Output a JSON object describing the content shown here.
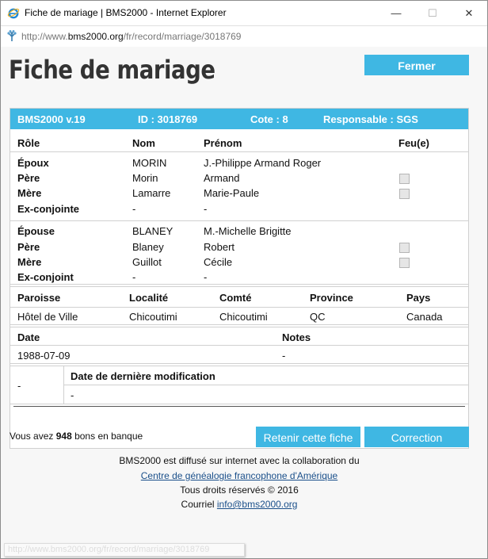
{
  "window": {
    "title": "Fiche de mariage | BMS2000 - Internet Explorer",
    "minimize": "—",
    "maximize": "☐",
    "close": "✕"
  },
  "address": {
    "prefix": "http://www.",
    "host": "bms2000.org",
    "path": "/fr/record/marriage/3018769"
  },
  "page": {
    "title": "Fiche de mariage",
    "close_button": "Fermer"
  },
  "record": {
    "header": {
      "version": "BMS2000 v.19",
      "id": "ID : 3018769",
      "cote": "Cote : 8",
      "responsable": "Responsable : SGS"
    },
    "columns": {
      "role": "Rôle",
      "nom": "Nom",
      "prenom": "Prénom",
      "feu": "Feu(e)"
    },
    "groom_group": [
      {
        "role": "Époux",
        "nom": "MORIN",
        "prenom": "J.-Philippe Armand Roger",
        "checkbox": false
      },
      {
        "role": "Père",
        "nom": "Morin",
        "prenom": "Armand",
        "checkbox": true
      },
      {
        "role": "Mère",
        "nom": "Lamarre",
        "prenom": "Marie-Paule",
        "checkbox": true
      },
      {
        "role": "Ex-conjointe",
        "nom": "-",
        "prenom": "-",
        "checkbox": false
      }
    ],
    "bride_group": [
      {
        "role": "Épouse",
        "nom": "BLANEY",
        "prenom": "M.-Michelle Brigitte",
        "checkbox": false
      },
      {
        "role": "Père",
        "nom": "Blaney",
        "prenom": "Robert",
        "checkbox": true
      },
      {
        "role": "Mère",
        "nom": "Guillot",
        "prenom": "Cécile",
        "checkbox": true
      },
      {
        "role": "Ex-conjoint",
        "nom": "-",
        "prenom": "-",
        "checkbox": false
      }
    ],
    "place": {
      "labels": {
        "paroisse": "Paroisse",
        "localite": "Localité",
        "comte": "Comté",
        "province": "Province",
        "pays": "Pays"
      },
      "values": {
        "paroisse": "Hôtel de Ville",
        "localite": "Chicoutimi",
        "comte": "Chicoutimi",
        "province": "QC",
        "pays": "Canada"
      }
    },
    "date": {
      "label": "Date",
      "value": "1988-07-09",
      "notes_label": "Notes",
      "notes_value": "-"
    },
    "modification": {
      "left_value": "-",
      "label": "Date de dernière modification",
      "value": "-"
    }
  },
  "bank": {
    "prefix": "Vous avez ",
    "count": "948",
    "suffix": " bons en banque"
  },
  "buttons": {
    "retenir": "Retenir cette fiche",
    "correction": "Correction"
  },
  "footer": {
    "line1": "BMS2000 est diffusé sur internet avec la collaboration du",
    "link1": "Centre de généalogie francophone d'Amérique",
    "line3": "Tous droits réservés © 2016",
    "line4_prefix": "Courriel ",
    "email": "info@bms2000.org"
  },
  "status_url": "http://www.bms2000.org/fr/record/marriage/3018769",
  "colors": {
    "accent": "#3fb7e3",
    "link": "#1a4f8a"
  }
}
